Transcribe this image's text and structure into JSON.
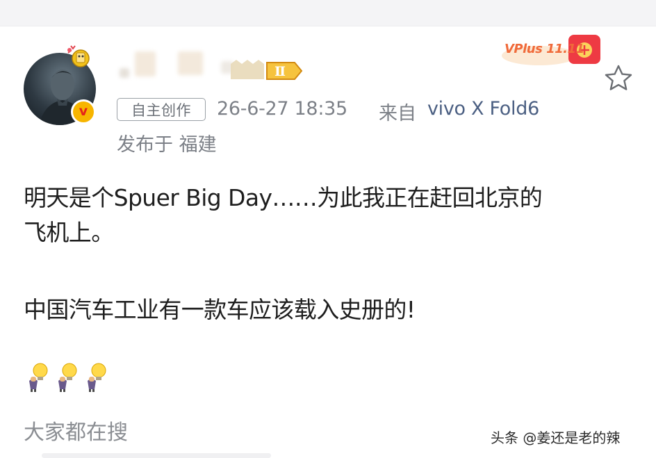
{
  "post": {
    "author": {
      "username": "",
      "vip_level": "Ⅱ",
      "verified_symbol": "v"
    },
    "meta": {
      "tag": "自主创作",
      "timestamp": "26-6-27 18:35",
      "source_prefix": "来自",
      "source_device": "vivo X Fold6",
      "location": "发布于 福建"
    },
    "body": {
      "line1": "明天是个Spuer Big Day……为此我正在赶回北京的",
      "line2": "飞机上。",
      "line3": "中国汽车工业有一款车应该载入史册的!"
    },
    "emojis": [
      "doge-lightbulb",
      "doge-lightbulb",
      "doge-lightbulb"
    ]
  },
  "promo": {
    "badge_text": "VPlus 11.11"
  },
  "trending_label": "大家都在搜",
  "watermark": "头条 @姜还是老的辣",
  "colors": {
    "text_primary": "#1e1e1e",
    "text_meta": "#7c8087",
    "link": "#4b5f82",
    "accent_orange": "#f06a3a",
    "verified_gold": "#f7b500"
  }
}
